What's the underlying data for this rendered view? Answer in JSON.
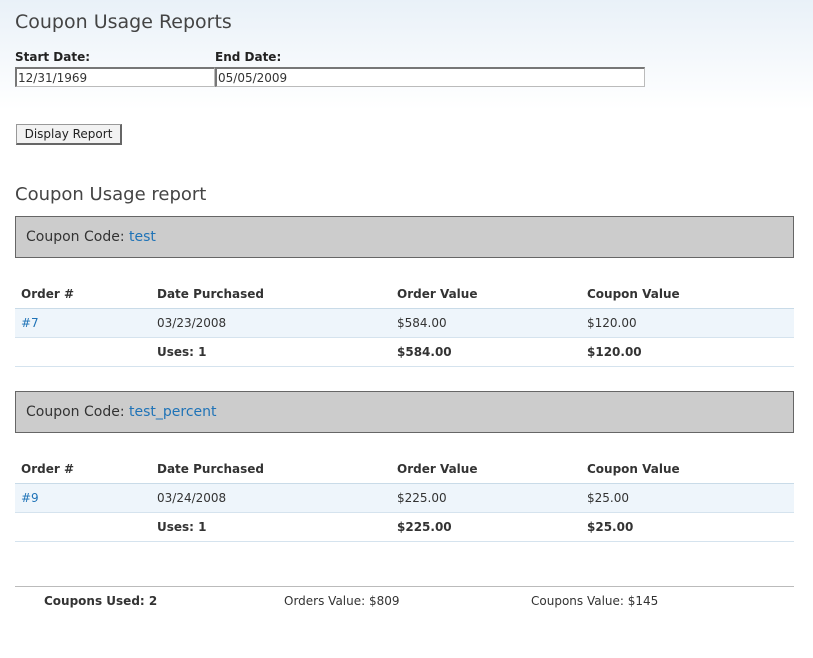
{
  "page": {
    "title": "Coupon Usage Reports"
  },
  "filters": {
    "start_label": "Start Date:",
    "start_value": "12/31/1969",
    "end_label": "End Date:",
    "end_value": "05/05/2009",
    "button_label": "Display Report"
  },
  "report": {
    "title": "Coupon Usage report",
    "code_label": "Coupon Code:",
    "columns": [
      "Order #",
      "Date Purchased",
      "Order Value",
      "Coupon Value"
    ],
    "coupons": [
      {
        "code": "test",
        "order": "#7",
        "date": "03/23/2008",
        "order_value": "$584.00",
        "coupon_value": "$120.00",
        "uses": "Uses: 1",
        "total_order_value": "$584.00",
        "total_coupon_value": "$120.00"
      },
      {
        "code": "test_percent",
        "order": "#9",
        "date": "03/24/2008",
        "order_value": "$225.00",
        "coupon_value": "$25.00",
        "uses": "Uses: 1",
        "total_order_value": "$225.00",
        "total_coupon_value": "$25.00"
      }
    ]
  },
  "summary": {
    "coupons_used": "Coupons Used: 2",
    "orders_value": "Orders Value: $809",
    "coupons_value": "Coupons Value: $145"
  }
}
